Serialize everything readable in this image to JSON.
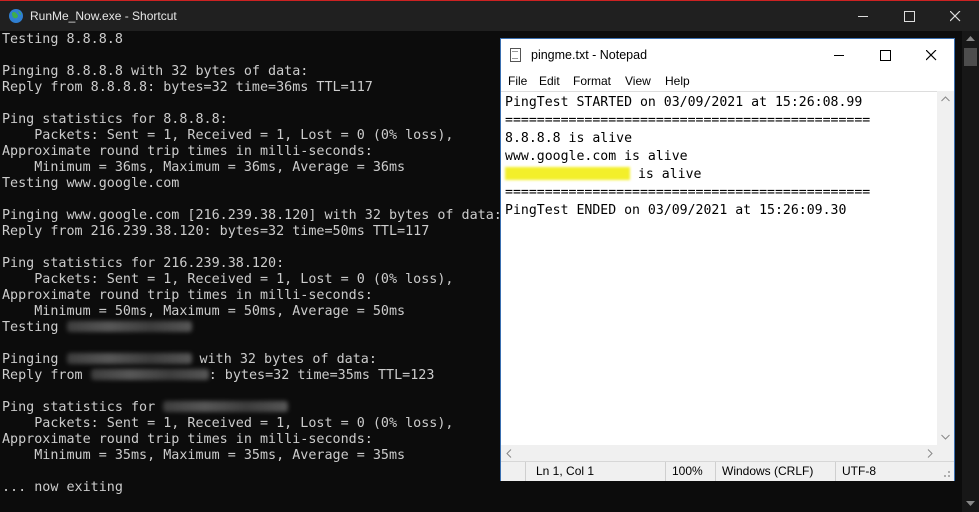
{
  "console": {
    "title": "RunMe_Now.exe - Shortcut",
    "lines": [
      "Testing 8.8.8.8",
      "",
      "Pinging 8.8.8.8 with 32 bytes of data:",
      "Reply from 8.8.8.8: bytes=32 time=36ms TTL=117",
      "",
      "Ping statistics for 8.8.8.8:",
      "    Packets: Sent = 1, Received = 1, Lost = 0 (0% loss),",
      "Approximate round trip times in milli-seconds:",
      "    Minimum = 36ms, Maximum = 36ms, Average = 36ms",
      "Testing www.google.com",
      "",
      "Pinging www.google.com [216.239.38.120] with 32 bytes of data:",
      "Reply from 216.239.38.120: bytes=32 time=50ms TTL=117",
      "",
      "Ping statistics for 216.239.38.120:",
      "    Packets: Sent = 1, Received = 1, Lost = 0 (0% loss),",
      "Approximate round trip times in milli-seconds:",
      "    Minimum = 50ms, Maximum = 50ms, Average = 50ms",
      "Testing ",
      "",
      "Pinging ",
      "Reply from ",
      "",
      "Ping statistics for ",
      "    Packets: Sent = 1, Received = 1, Lost = 0 (0% loss),",
      "Approximate round trip times in milli-seconds:",
      "    Minimum = 35ms, Maximum = 35ms, Average = 35ms",
      "",
      "... now exiting"
    ],
    "suffixes": {
      "pinging": " with 32 bytes of data:",
      "reply": ": bytes=32 time=35ms TTL=123"
    }
  },
  "notepad": {
    "title": "pingme.txt - Notepad",
    "menu": [
      "File",
      "Edit",
      "Format",
      "View",
      "Help"
    ],
    "lines": [
      "PingTest STARTED on 03/09/2021 at 15:26:08.99",
      "==============================================",
      "8.8.8.8 is alive",
      "www.google.com is alive",
      " is alive",
      "==============================================",
      "PingTest ENDED on 03/09/2021 at 15:26:09.30"
    ],
    "status": {
      "position": "Ln 1, Col 1",
      "zoom": "100%",
      "line_ending": "Windows (CRLF)",
      "encoding": "UTF-8"
    }
  },
  "icons": {
    "console_app": "globe-icon",
    "minimize": "minimize-icon",
    "maximize": "maximize-icon",
    "close": "close-icon",
    "notepad_app": "notepad-icon"
  }
}
